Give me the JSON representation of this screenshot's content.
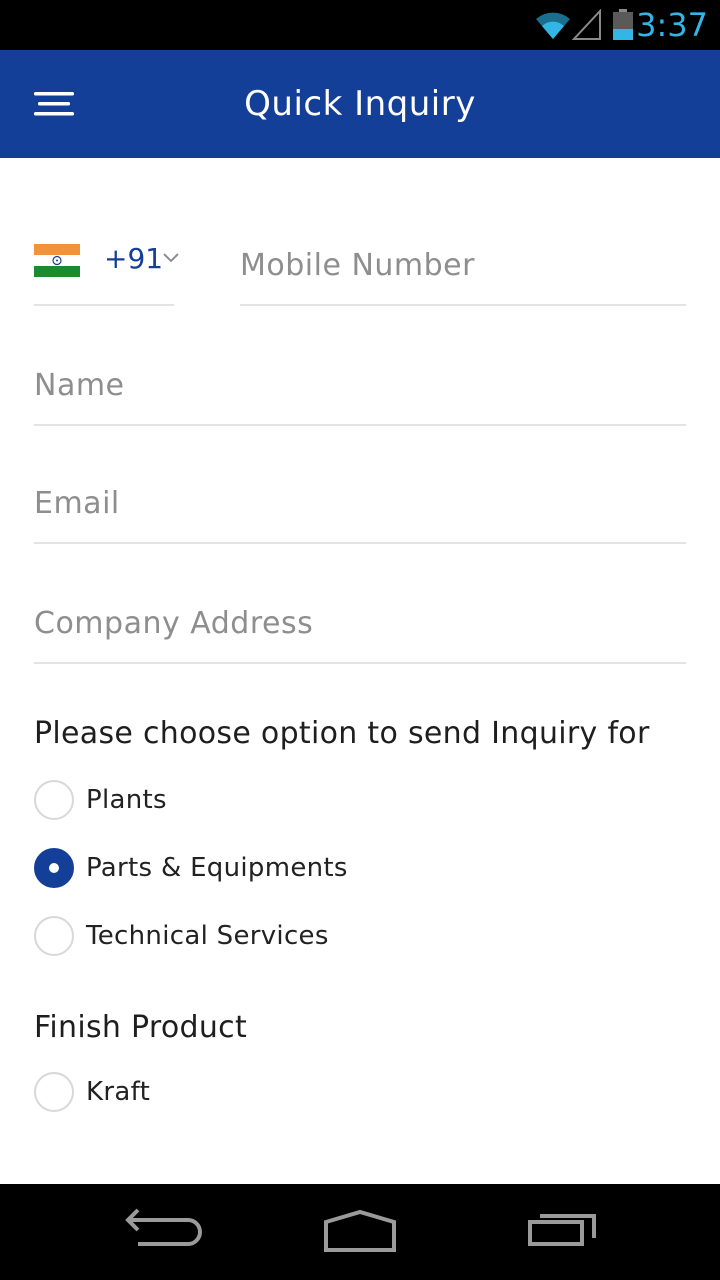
{
  "status_bar": {
    "time": "3:37",
    "icons": [
      "wifi-icon",
      "signal-icon",
      "battery-icon"
    ],
    "accent_color": "#33b5e5"
  },
  "app_bar": {
    "title": "Quick Inquiry",
    "menu_icon": "menu-icon",
    "background_color": "#143f98"
  },
  "form": {
    "country": {
      "flag": "india-flag-icon",
      "code": "+91"
    },
    "mobile": {
      "placeholder": "Mobile Number",
      "value": ""
    },
    "name": {
      "placeholder": "Name",
      "value": ""
    },
    "email": {
      "placeholder": "Email",
      "value": ""
    },
    "address": {
      "placeholder": "Company Address",
      "value": ""
    }
  },
  "inquiry": {
    "heading": "Please choose option to send Inquiry for",
    "options": [
      {
        "label": "Plants",
        "checked": false
      },
      {
        "label": "Parts & Equipments",
        "checked": true
      },
      {
        "label": "Technical Services",
        "checked": false
      }
    ]
  },
  "finish_product": {
    "heading": "Finish Product",
    "options": [
      {
        "label": "Kraft",
        "checked": false
      }
    ]
  },
  "nav_bar": {
    "icons": [
      "back-icon",
      "home-icon",
      "recents-icon"
    ]
  }
}
